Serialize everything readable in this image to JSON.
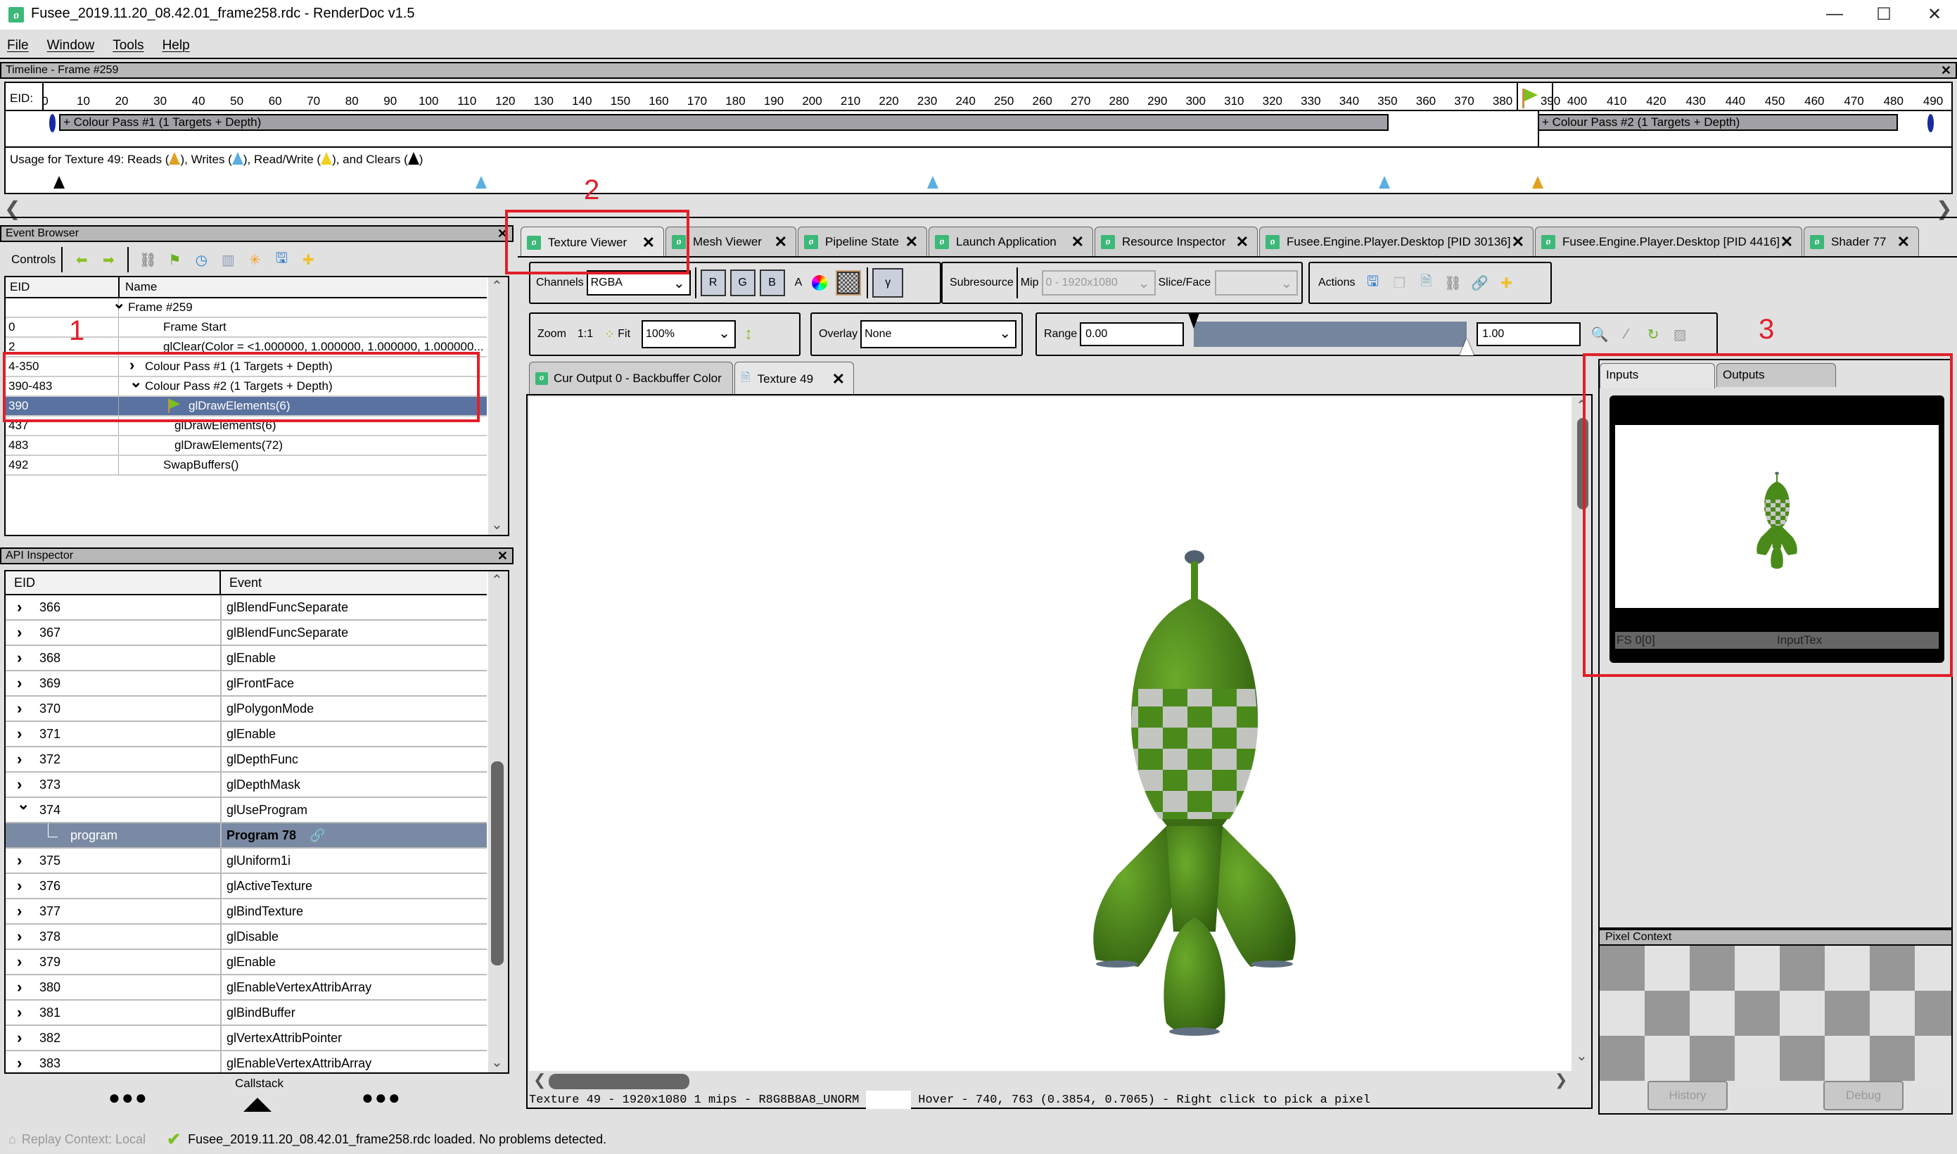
{
  "window": {
    "title": "Fusee_2019.11.20_08.42.01_frame258.rdc - RenderDoc v1.5",
    "minimize": "—",
    "maximize": "☐",
    "close": "✕"
  },
  "menu": [
    "File",
    "Window",
    "Tools",
    "Help"
  ],
  "timeline": {
    "title": "Timeline - Frame #259",
    "eid_label": "EID:",
    "ticks": [
      "0",
      "10",
      "20",
      "30",
      "40",
      "50",
      "60",
      "70",
      "80",
      "90",
      "100",
      "110",
      "120",
      "130",
      "140",
      "150",
      "160",
      "170",
      "180",
      "190",
      "200",
      "210",
      "220",
      "230",
      "240",
      "250",
      "260",
      "270",
      "280",
      "290",
      "300",
      "310",
      "320",
      "330",
      "340",
      "350",
      "360",
      "370",
      "380",
      "390",
      "400",
      "410",
      "420",
      "430",
      "440",
      "450",
      "460",
      "470",
      "480",
      "490"
    ],
    "current_eid": 390,
    "passes": [
      {
        "label": "+ Colour Pass #1 (1 Targets + Depth)",
        "start": 4,
        "end": 350
      },
      {
        "label": "+ Colour Pass #2 (1 Targets + Depth)",
        "start": 390,
        "end": 483
      }
    ],
    "usage_label": "Usage for Texture 49: Reads (▲), Writes (▲), Read/Write (▲), and Clears (▲)",
    "usage_parts": {
      "prefix": "Usage for Texture 49: Reads (",
      "writes": "), Writes (",
      "rw": "), Read/Write (",
      "clears": "), and Clears (",
      "suffix": ")"
    },
    "usage_markers": [
      {
        "eid": 2,
        "kind": "clear",
        "color": "#000000"
      },
      {
        "eid": 112,
        "kind": "write",
        "color": "#5aafe0"
      },
      {
        "eid": 230,
        "kind": "write",
        "color": "#5aafe0"
      },
      {
        "eid": 348,
        "kind": "write",
        "color": "#5aafe0"
      },
      {
        "eid": 390,
        "kind": "read",
        "color": "#e0a020"
      }
    ],
    "colors": {
      "read": "#e0a020",
      "write": "#5aafe0",
      "readwrite": "#f0d020",
      "clear": "#000000"
    }
  },
  "event_browser": {
    "title": "Event Browser",
    "controls_label": "Controls",
    "columns": [
      "EID",
      "Name"
    ],
    "rows": [
      {
        "eid": "",
        "name": "Frame #259",
        "expander": "v"
      },
      {
        "eid": "0",
        "name": "Frame Start",
        "expander": ""
      },
      {
        "eid": "2",
        "name": "glClear(Color = <1.000000, 1.000000, 1.000000, 1.000000...",
        "expander": ""
      },
      {
        "eid": "4-350",
        "name": "Colour Pass #1 (1 Targets + Depth)",
        "expander": ">"
      },
      {
        "eid": "390-483",
        "name": "Colour Pass #2 (1 Targets + Depth)",
        "expander": "v"
      },
      {
        "eid": "390",
        "name": "glDrawElements(6)",
        "expander": "",
        "selected": true
      },
      {
        "eid": "437",
        "name": "glDrawElements(6)",
        "expander": ""
      },
      {
        "eid": "483",
        "name": "glDrawElements(72)",
        "expander": ""
      },
      {
        "eid": "492",
        "name": "SwapBuffers()",
        "expander": ""
      }
    ]
  },
  "api_inspector": {
    "title": "API Inspector",
    "columns": [
      "EID",
      "Event"
    ],
    "rows": [
      {
        "eid": "366",
        "event": "glBlendFuncSeparate"
      },
      {
        "eid": "367",
        "event": "glBlendFuncSeparate"
      },
      {
        "eid": "368",
        "event": "glEnable"
      },
      {
        "eid": "369",
        "event": "glFrontFace"
      },
      {
        "eid": "370",
        "event": "glPolygonMode"
      },
      {
        "eid": "371",
        "event": "glEnable"
      },
      {
        "eid": "372",
        "event": "glDepthFunc"
      },
      {
        "eid": "373",
        "event": "glDepthMask"
      },
      {
        "eid": "374",
        "event": "glUseProgram",
        "expanded": true
      },
      {
        "eid": "program",
        "event": "Program 78",
        "child": true,
        "selected": true
      },
      {
        "eid": "375",
        "event": "glUniform1i"
      },
      {
        "eid": "376",
        "event": "glActiveTexture"
      },
      {
        "eid": "377",
        "event": "glBindTexture"
      },
      {
        "eid": "378",
        "event": "glDisable"
      },
      {
        "eid": "379",
        "event": "glEnable"
      },
      {
        "eid": "380",
        "event": "glEnableVertexAttribArray"
      },
      {
        "eid": "381",
        "event": "glBindBuffer"
      },
      {
        "eid": "382",
        "event": "glVertexAttribPointer"
      },
      {
        "eid": "383",
        "event": "glEnableVertexAttribArray"
      }
    ],
    "callstack_label": "Callstack"
  },
  "tabs": [
    {
      "label": "Texture Viewer",
      "active": true
    },
    {
      "label": "Mesh Viewer"
    },
    {
      "label": "Pipeline State"
    },
    {
      "label": "Launch Application"
    },
    {
      "label": "Resource Inspector"
    },
    {
      "label": "Fusee.Engine.Player.Desktop [PID 30136]"
    },
    {
      "label": "Fusee.Engine.Player.Desktop [PID 4416]"
    },
    {
      "label": "Shader 77"
    }
  ],
  "texture_viewer": {
    "channels_label": "Channels",
    "channels_value": "RGBA",
    "channel_buttons": [
      "R",
      "G",
      "B"
    ],
    "alpha_label": "A",
    "gamma_label": "γ",
    "subresource_label": "Subresource",
    "mip_label": "Mip",
    "mip_value": "0 - 1920x1080",
    "slice_label": "Slice/Face",
    "slice_value": "",
    "actions_label": "Actions",
    "zoom_label": "Zoom",
    "zoom_1to1": "1:1",
    "fit_label": "Fit",
    "zoom_value": "100%",
    "overlay_label": "Overlay",
    "overlay_value": "None",
    "range_label": "Range",
    "range_min": "0.00",
    "range_max": "1.00",
    "range_fraction": [
      0.0,
      1.0
    ],
    "inner_tabs": [
      {
        "label": "Cur Output 0 - Backbuffer Color"
      },
      {
        "label": "Texture 49",
        "active": true,
        "closable": true
      }
    ],
    "status_info": "Texture 49 - 1920x1080 1 mips - R8G8B8A8_UNORM",
    "status_hover": "Hover -  740,  763 (0.3854, 0.7065) - Right click to pick a pixel"
  },
  "right_panel": {
    "tabs": [
      "Inputs",
      "Outputs"
    ],
    "thumb_label_left": "FS 0[0]",
    "thumb_label_right": "InputTex",
    "pixel_context_title": "Pixel Context",
    "history_button": "History",
    "debug_button": "Debug"
  },
  "status_bar": {
    "replay_context": "Replay Context: Local",
    "message": "Fusee_2019.11.20_08.42.01_frame258.rdc loaded. No problems detected."
  },
  "annotations": [
    "1",
    "2",
    "3"
  ],
  "colors": {
    "accent_green": "#3cb878",
    "selection": "#5a72a0",
    "annotation_red": "#e0202a",
    "rocket_green": "#4a8a1a"
  }
}
